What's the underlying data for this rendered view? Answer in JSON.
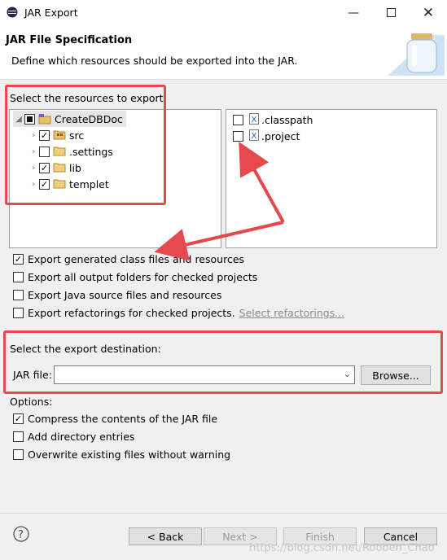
{
  "window": {
    "title": "JAR Export"
  },
  "header": {
    "title": "JAR File Specification",
    "description": "Define which resources should be exported into the JAR."
  },
  "resources": {
    "label": "Select the resources to export:",
    "tree": [
      {
        "label": "CreateDBDoc",
        "state": "partial",
        "expanded": true,
        "icon": "project-icon"
      },
      {
        "label": "src",
        "state": "checked",
        "icon": "package-folder-icon"
      },
      {
        "label": ".settings",
        "state": "unchecked",
        "icon": "folder-icon"
      },
      {
        "label": "lib",
        "state": "checked",
        "icon": "folder-icon"
      },
      {
        "label": "templet",
        "state": "checked",
        "icon": "folder-icon"
      }
    ],
    "files": [
      {
        "label": ".classpath",
        "state": "unchecked",
        "icon": "xml-file-icon"
      },
      {
        "label": ".project",
        "state": "unchecked",
        "icon": "xml-file-icon"
      }
    ]
  },
  "export_options": [
    {
      "label": "Export generated class files and resources",
      "checked": true
    },
    {
      "label": "Export all output folders for checked projects",
      "checked": false
    },
    {
      "label": "Export Java source files and resources",
      "checked": false
    },
    {
      "label": "Export refactorings for checked projects.",
      "checked": false,
      "link": "Select refactorings..."
    }
  ],
  "destination": {
    "label": "Select the export destination:",
    "jar_file_label": "JAR file:",
    "jar_file_value": "",
    "browse_label": "Browse..."
  },
  "options": {
    "label": "Options:",
    "items": [
      {
        "label": "Compress the contents of the JAR file",
        "checked": true
      },
      {
        "label": "Add directory entries",
        "checked": false
      },
      {
        "label": "Overwrite existing files without warning",
        "checked": false
      }
    ]
  },
  "footer": {
    "back_label": "< Back",
    "next_label": "Next >",
    "finish_label": "Finish",
    "cancel_label": "Cancel",
    "watermark": "https://blog.csdn.net/Rooben_Chao"
  },
  "colors": {
    "highlight": "#e5484d",
    "link": "#8a8a8a"
  }
}
